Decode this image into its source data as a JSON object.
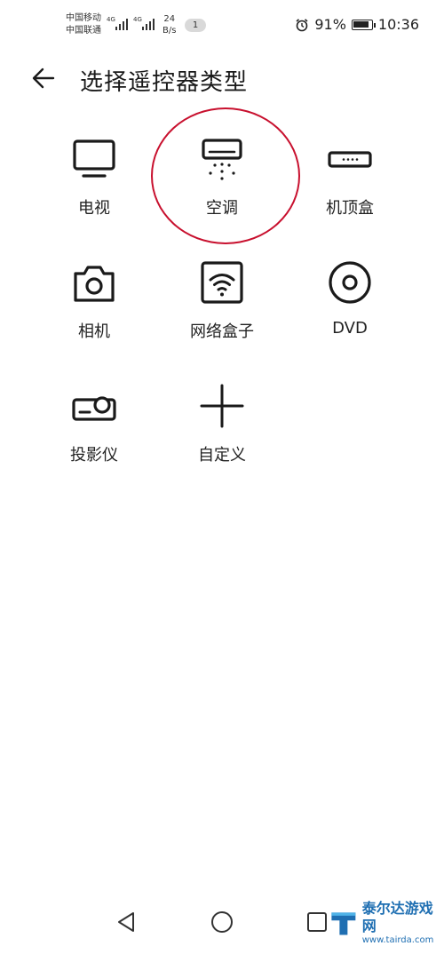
{
  "status_bar": {
    "carrier_1": "中国移动",
    "carrier_2": "中国联通",
    "net_1": "4G",
    "net_2": "4G",
    "net_speed_value": "24",
    "net_speed_unit": "B/s",
    "notification_count": "1",
    "battery_percent": "91%",
    "battery_level": 0.91,
    "time": "10:36"
  },
  "header": {
    "title": "选择遥控器类型"
  },
  "device_types": [
    {
      "label": "电视",
      "icon": "tv-icon"
    },
    {
      "label": "空调",
      "icon": "air-conditioner-icon"
    },
    {
      "label": "机顶盒",
      "icon": "set-top-box-icon"
    },
    {
      "label": "相机",
      "icon": "camera-icon"
    },
    {
      "label": "网络盒子",
      "icon": "network-box-icon"
    },
    {
      "label": "DVD",
      "icon": "dvd-icon"
    },
    {
      "label": "投影仪",
      "icon": "projector-icon"
    },
    {
      "label": "自定义",
      "icon": "plus-icon"
    }
  ],
  "highlight_color": "#c8102e",
  "watermark": {
    "name": "泰尔达游戏网",
    "url": "www.tairda.com"
  }
}
